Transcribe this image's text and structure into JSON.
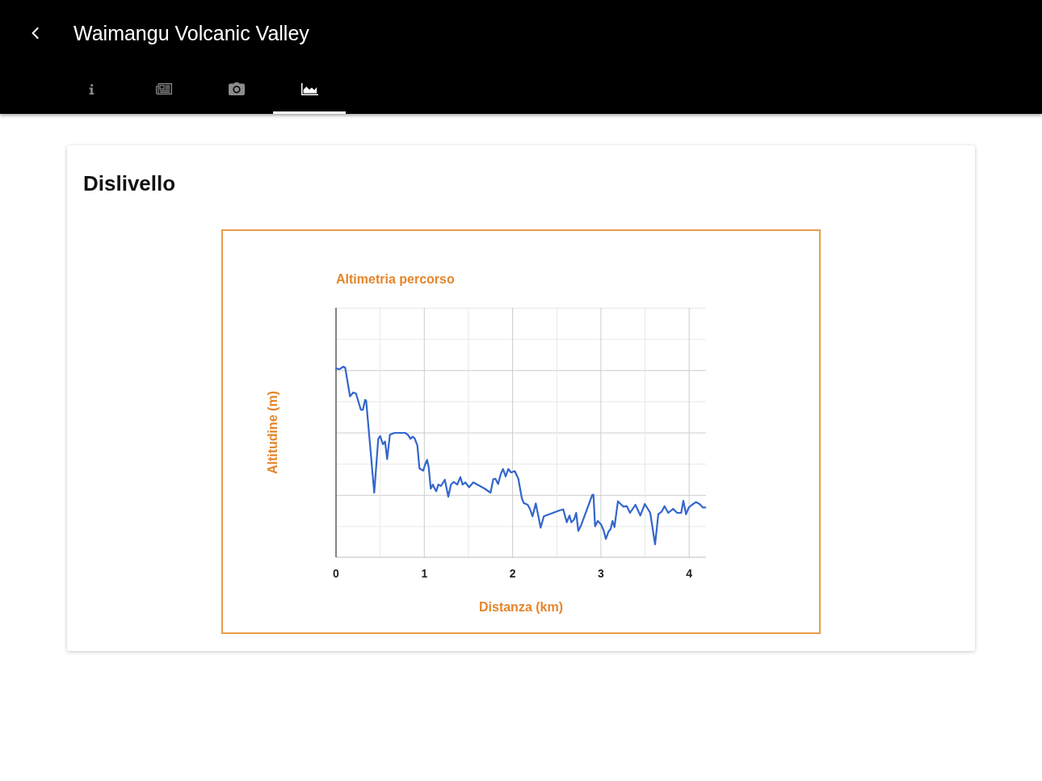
{
  "header": {
    "title": "Waimangu Volcanic Valley",
    "tabs": [
      {
        "kind": "info",
        "selected": false
      },
      {
        "kind": "news",
        "selected": false
      },
      {
        "kind": "camera",
        "selected": false
      },
      {
        "kind": "chart",
        "selected": true
      }
    ]
  },
  "card": {
    "title": "Dislivello",
    "chart": {
      "title": "Altimetria percorso",
      "ylabel": "Altitudine (m)",
      "xlabel": "Distanza (km)",
      "x_tick_labels": [
        "0",
        "1",
        "2",
        "3",
        "4"
      ]
    }
  }
}
